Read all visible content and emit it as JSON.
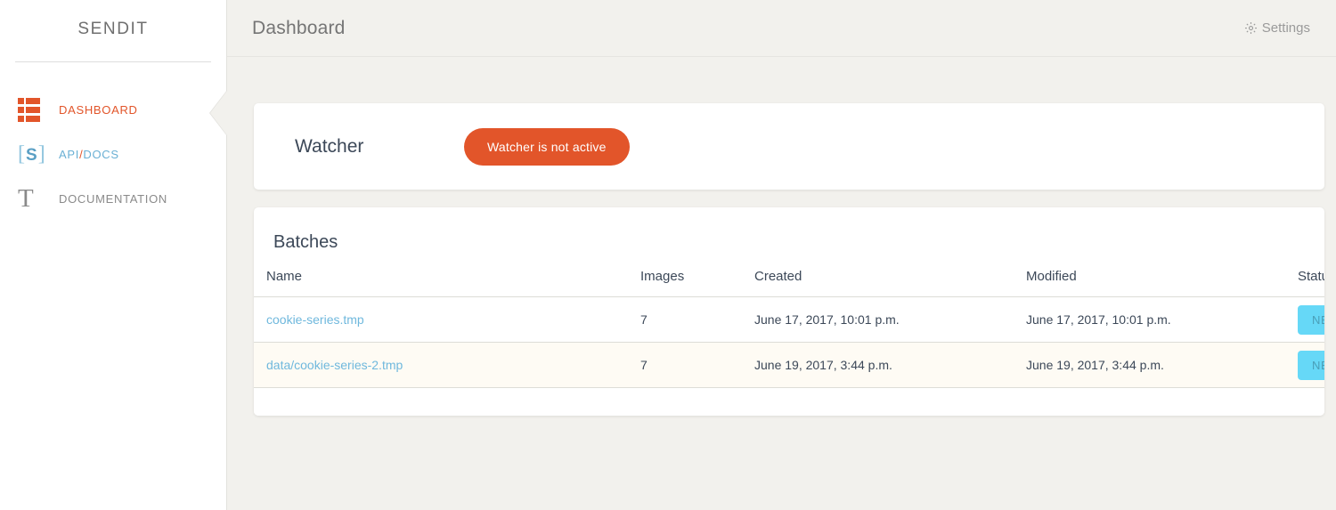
{
  "brand": {
    "name": "SENDIT"
  },
  "sidebar": {
    "items": [
      {
        "id": "dashboard",
        "label": "DASHBOARD",
        "icon": "dashboard-rows-icon",
        "state": "active"
      },
      {
        "id": "api-docs",
        "label_a": "API",
        "separator": "/",
        "label_b": "DOCS",
        "icon": "s-bracket-icon",
        "state": "link"
      },
      {
        "id": "documentation",
        "label": "DOCUMENTATION",
        "icon": "serif-t-icon",
        "state": "default"
      }
    ]
  },
  "header": {
    "title": "Dashboard",
    "settings_label": "Settings",
    "settings_icon": "gear-icon"
  },
  "watcher": {
    "title": "Watcher",
    "status_button": "Watcher is not active"
  },
  "batches": {
    "title": "Batches",
    "columns": [
      "Name",
      "Images",
      "Created",
      "Modified",
      "Status"
    ],
    "rows": [
      {
        "name": "cookie-series.tmp",
        "images": "7",
        "created": "June 17, 2017, 10:01 p.m.",
        "modified": "June 17, 2017, 10:01 p.m.",
        "status": "NEW"
      },
      {
        "name": "data/cookie-series-2.tmp",
        "images": "7",
        "created": "June 19, 2017, 3:44 p.m.",
        "modified": "June 19, 2017, 3:44 p.m.",
        "status": "NEW"
      }
    ]
  },
  "colors": {
    "accent_orange": "#e2552a",
    "link_blue": "#6fb8dd",
    "badge_blue": "#66d8f7",
    "page_bg": "#f2f1ed",
    "alt_row": "#fefbf4"
  }
}
